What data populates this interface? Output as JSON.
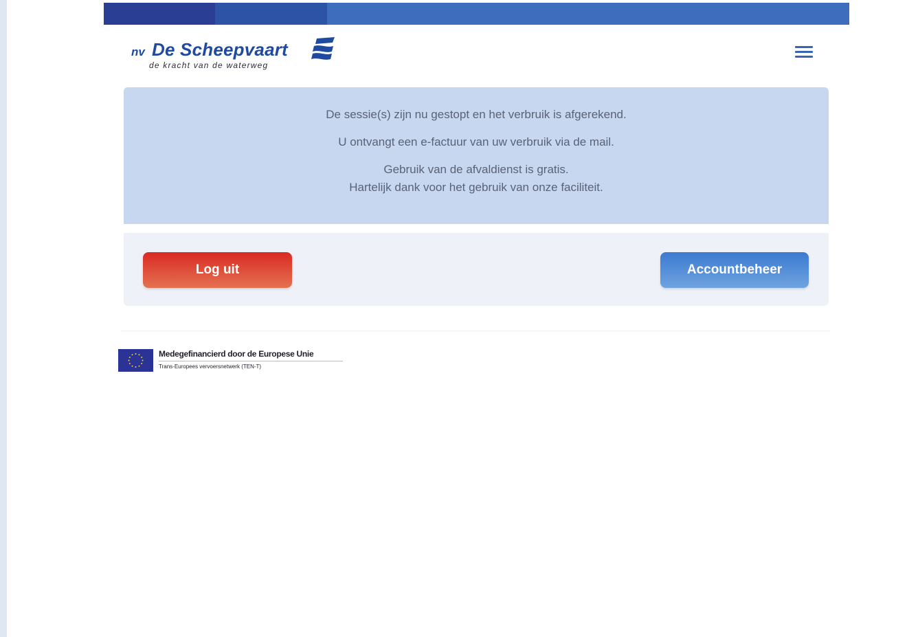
{
  "header": {
    "logo": {
      "prefix": "nv",
      "brand": "De Scheepvaart",
      "tagline": "de kracht van de waterweg"
    },
    "menu_icon": "hamburger-menu-icon"
  },
  "notice": {
    "line1": "De sessie(s) zijn nu gestopt en het verbruik is afgerekend.",
    "line2": "U ontvangt een e-factuur van uw verbruik via de mail.",
    "line3": "Gebruik van de afvaldienst is gratis.",
    "line4": "Hartelijk dank voor het gebruik van onze faciliteit."
  },
  "actions": {
    "logout_label": "Log uit",
    "account_label": "Accountbeheer"
  },
  "footer": {
    "eu_title": "Medegefinancierd door de Europese Unie",
    "eu_subtitle": "Trans-Europees vervoersnetwerk (TEN-T)"
  },
  "colors": {
    "brand_blue": "#1f4aa0",
    "notice_bg": "#c7d7ef",
    "logout_red": "#d92a25",
    "account_blue": "#3c7ad0"
  }
}
